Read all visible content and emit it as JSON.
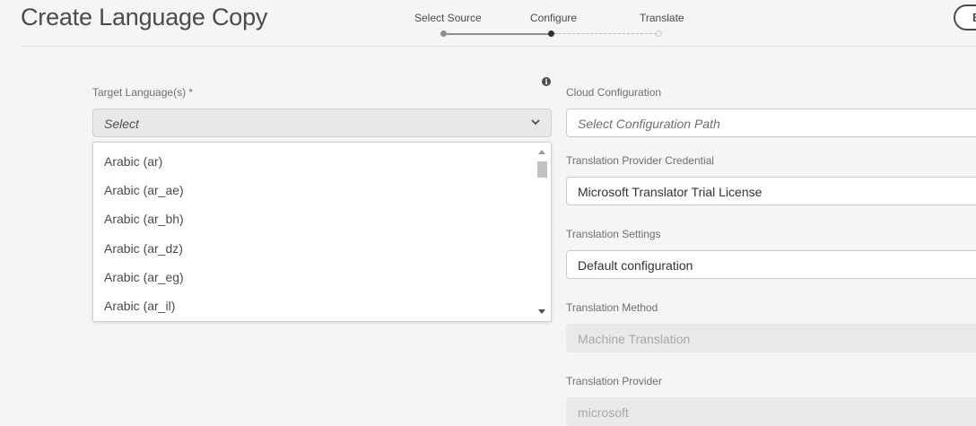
{
  "page": {
    "title": "Create Language Copy"
  },
  "stepper": {
    "steps": [
      {
        "label": "Select Source",
        "state": "done"
      },
      {
        "label": "Configure",
        "state": "current"
      },
      {
        "label": "Translate",
        "state": "future"
      }
    ]
  },
  "header_action": {
    "label": "B"
  },
  "target_language": {
    "label": "Target Language(s) *",
    "placeholder": "Select",
    "info_icon": "info-icon",
    "options": [
      "Arabic (ar)",
      "Arabic (ar_ae)",
      "Arabic (ar_bh)",
      "Arabic (ar_dz)",
      "Arabic (ar_eg)",
      "Arabic (ar_il)"
    ]
  },
  "cloud_configuration": {
    "label": "Cloud Configuration",
    "placeholder": "Select Configuration Path"
  },
  "provider_credential": {
    "label": "Translation Provider Credential",
    "value": "Microsoft Translator Trial License"
  },
  "translation_settings": {
    "label": "Translation Settings",
    "value": "Default configuration"
  },
  "translation_method": {
    "label": "Translation Method",
    "value": "Machine Translation"
  },
  "translation_provider": {
    "label": "Translation Provider",
    "value": "microsoft"
  },
  "colors": {
    "background": "#f5f5f5",
    "text": "#323232",
    "disabled_field": "#e9e9e9"
  }
}
